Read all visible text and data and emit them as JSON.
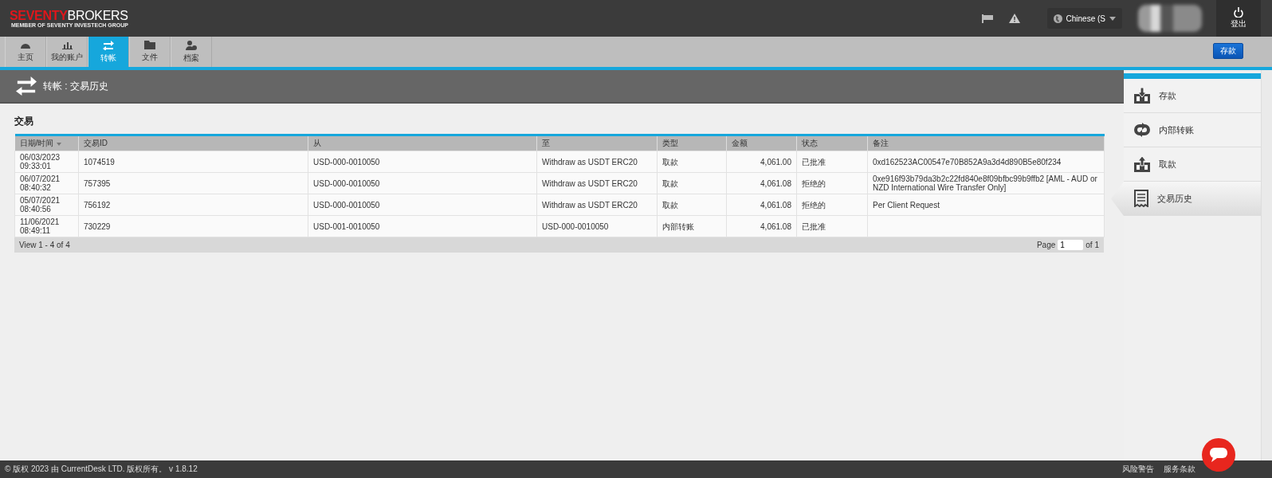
{
  "header": {
    "logo": {
      "brand_accent": "SEVENTY",
      "brand_rest": "BROKERS",
      "tagline": "MEMBER OF SEVENTY INVESTECH GROUP"
    },
    "language": "Chinese (S",
    "logout": "登出"
  },
  "nav": {
    "tabs": [
      {
        "label": "主页",
        "kind": "dashboard",
        "selected": false
      },
      {
        "label": "我的账户",
        "kind": "accounts",
        "selected": false
      },
      {
        "label": "转帐",
        "kind": "transfer",
        "selected": true
      },
      {
        "label": "文件",
        "kind": "documents",
        "selected": false
      },
      {
        "label": "档案",
        "kind": "profile",
        "selected": false
      }
    ],
    "deposit_button": "存款"
  },
  "page_title": "转帐 : 交易历史",
  "section_title": "交易",
  "table": {
    "columns": [
      {
        "label": "日期/时间",
        "sorted": true,
        "kind": "text"
      },
      {
        "label": "交易ID",
        "sorted": false,
        "kind": "text"
      },
      {
        "label": "从",
        "sorted": false,
        "kind": "text"
      },
      {
        "label": "至",
        "sorted": false,
        "kind": "text"
      },
      {
        "label": "类型",
        "sorted": false,
        "kind": "text"
      },
      {
        "label": "金额",
        "sorted": false,
        "kind": "amount"
      },
      {
        "label": "状态",
        "sorted": false,
        "kind": "text"
      },
      {
        "label": "备注",
        "sorted": false,
        "kind": "text"
      }
    ],
    "rows": [
      [
        "06/03/2023 09:33:01",
        "1074519",
        "USD-000-0010050",
        "Withdraw as USDT ERC20",
        "取款",
        "4,061.00",
        "已批准",
        "0xd162523AC00547e70B852A9a3d4d890B5e80f234"
      ],
      [
        "06/07/2021 08:40:32",
        "757395",
        "USD-000-0010050",
        "Withdraw as USDT ERC20",
        "取款",
        "4,061.08",
        "拒绝的",
        "0xe916f93b79da3b2c22fd840e8f09bfbc99b9ffb2 [AML - AUD or NZD International Wire Transfer Only]"
      ],
      [
        "05/07/2021 08:40:56",
        "756192",
        "USD-000-0010050",
        "Withdraw as USDT ERC20",
        "取款",
        "4,061.08",
        "拒绝的",
        "Per Client Request"
      ],
      [
        "11/06/2021 08:49:11",
        "730229",
        "USD-001-0010050",
        "USD-000-0010050",
        "内部转账",
        "4,061.08",
        "已批准",
        ""
      ]
    ],
    "pager": {
      "view": "View 1 - 4 of 4",
      "page_label": "Page",
      "page_value": "1",
      "page_total": "of 1"
    }
  },
  "sidebar": {
    "items": [
      {
        "label": "存款",
        "kind": "deposit",
        "selected": false
      },
      {
        "label": "内部转账",
        "kind": "internal",
        "selected": false
      },
      {
        "label": "取款",
        "kind": "withdraw",
        "selected": false
      },
      {
        "label": "交易历史",
        "kind": "history",
        "selected": true
      }
    ]
  },
  "footer": {
    "copyright": "© 版权 2023 由 CurrentDesk LTD. 版权所有。 v 1.8.12",
    "links": [
      "风险警告",
      "服务条款"
    ]
  }
}
